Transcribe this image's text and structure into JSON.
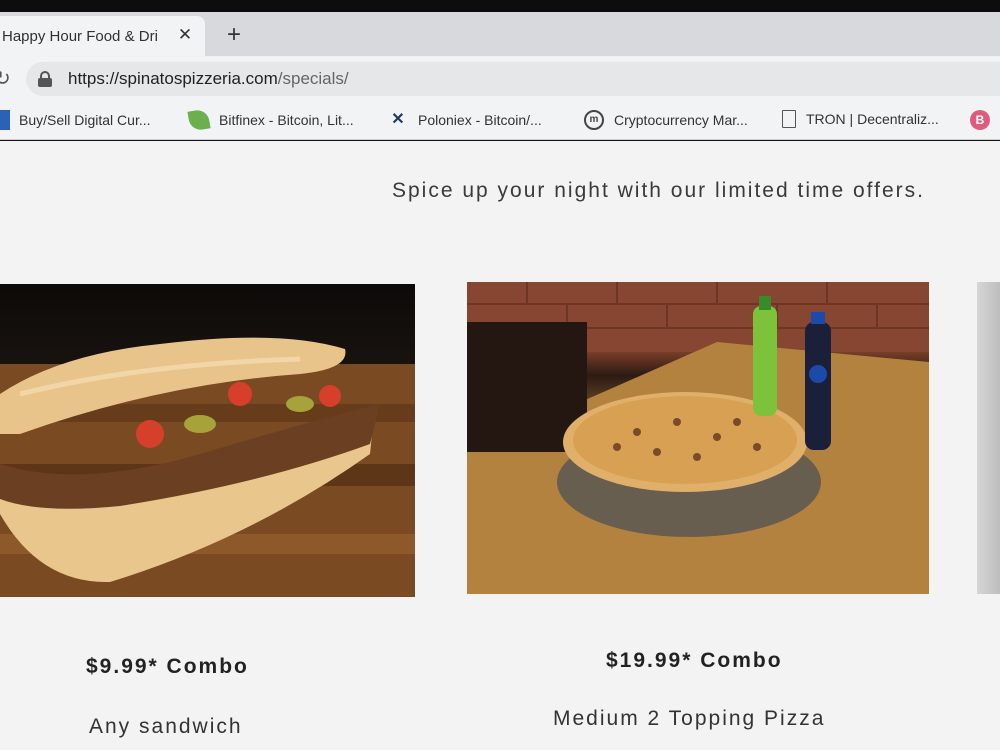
{
  "browser": {
    "tab_title": "Happy Hour Food & Dri",
    "tab_close": "✕",
    "new_tab": "+",
    "url_host": "https://spinatospizzeria.com",
    "url_path": "/specials/"
  },
  "bookmarks": [
    {
      "label": "Buy/Sell Digital Cur...",
      "icon": "square-blue-icon"
    },
    {
      "label": "Bitfinex - Bitcoin, Lit...",
      "icon": "leaf-icon"
    },
    {
      "label": "Poloniex - Bitcoin/...",
      "icon": "poloniex-x-icon"
    },
    {
      "label": "Cryptocurrency Mar...",
      "icon": "coinmarketcap-icon"
    },
    {
      "label": "TRON | Decentraliz...",
      "icon": "document-icon"
    },
    {
      "label": "B",
      "icon": "b-circle-icon"
    }
  ],
  "page": {
    "tagline": "Spice up your night with our limited time offers.",
    "specials": [
      {
        "price": "$9.99* Combo",
        "description": "Any sandwich",
        "image": "sandwich-photo"
      },
      {
        "price": "$19.99* Combo",
        "description": "Medium 2 Topping Pizza",
        "image": "pizza-photo"
      }
    ]
  },
  "colors": {
    "page_bg": "#f3f3f3",
    "chrome_bg": "#f2f3f4",
    "text": "#333333"
  }
}
